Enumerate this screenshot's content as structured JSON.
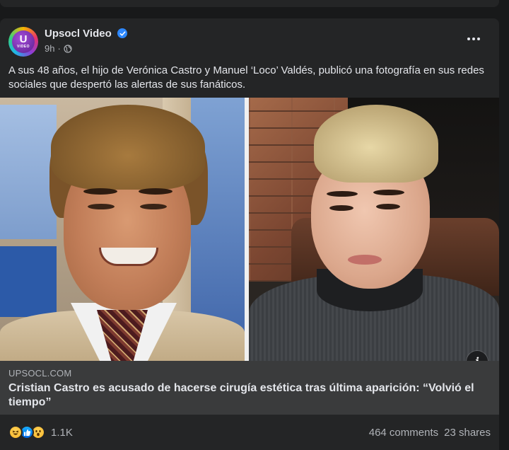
{
  "post": {
    "page_name": "Upsocl Video",
    "avatar_letter": "U",
    "avatar_sub": "VIDEO",
    "time": "9h",
    "caption": "A sus 48 años, el hijo de Verónica Castro y Manuel ‘Loco’ Valdés, publicó una fotografía en sus redes sociales que despertó las alertas de sus fanáticos."
  },
  "link": {
    "domain": "UPSOCL.COM",
    "title": "Cristian Castro es acusado de hacerse cirugía estética tras última aparición: “Volvió el tiempo”"
  },
  "stats": {
    "reaction_count": "1.1K",
    "comments": "464 comments",
    "shares": "23 shares"
  },
  "icons": {
    "verified": "verified-badge-icon",
    "privacy": "globe-icon",
    "more": "more-options-icon",
    "info": "info-icon",
    "reactions": [
      "haha-reaction-icon",
      "like-reaction-icon",
      "wow-reaction-icon"
    ]
  },
  "colors": {
    "background": "#18191a",
    "card": "#242526",
    "link_preview": "#3a3b3c",
    "primary_text": "#e4e6eb",
    "secondary_text": "#b0b3b8",
    "verified_blue": "#2d88ff"
  }
}
